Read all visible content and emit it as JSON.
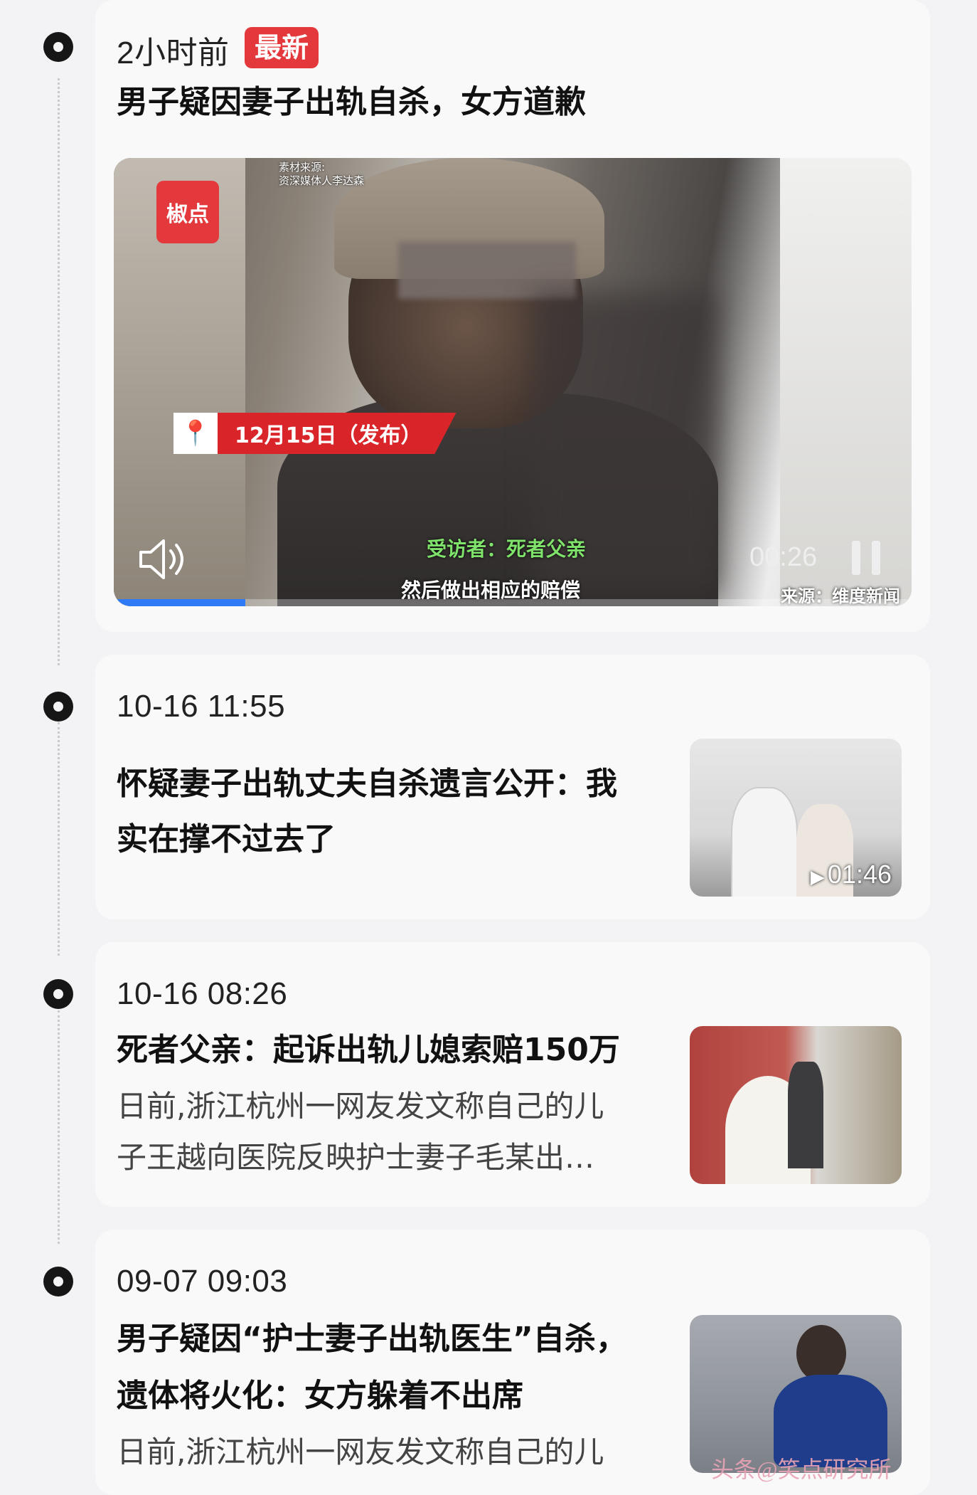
{
  "items": [
    {
      "time": "2小时前",
      "badge": "最新",
      "title": "男子疑因妻子出轨自杀，女方道歉",
      "video": {
        "logo_text": "椒点",
        "source_note_line1": "素材来源:",
        "source_note_line2": "资深媒体人李达森",
        "date_tag": "12月15日（发布）",
        "speaker_label": "受访者：死者父亲",
        "subtitle": "然后做出相应的赔偿",
        "timer": "00:26",
        "credit": "来源：维度新闻",
        "progress": 0.165
      }
    },
    {
      "time": "10-16 11:55",
      "title_line1": "怀疑妻子出轨丈夫自杀遗言公开：我",
      "title_line2": "实在撑不过去了",
      "duration": "01:46"
    },
    {
      "time": "10-16 08:26",
      "title": "死者父亲：起诉出轨儿媳索赔150万",
      "summary_line1": "日前,浙江杭州一网友发文称自己的儿",
      "summary_line2": "子王越向医院反映护士妻子毛某出…"
    },
    {
      "time": "09-07 09:03",
      "title_line1": "男子疑因“护士妻子出轨医生”自杀，",
      "title_line2": "遗体将火化：女方躲着不出席",
      "summary_line1": "日前,浙江杭州一网友发文称自己的儿"
    }
  ],
  "watermark": "头条@笑点研究所",
  "colors": {
    "accent": "#e4393c",
    "progress": "#2f7bf6",
    "background": "#f3f3f5",
    "card": "#f9f9fa"
  }
}
